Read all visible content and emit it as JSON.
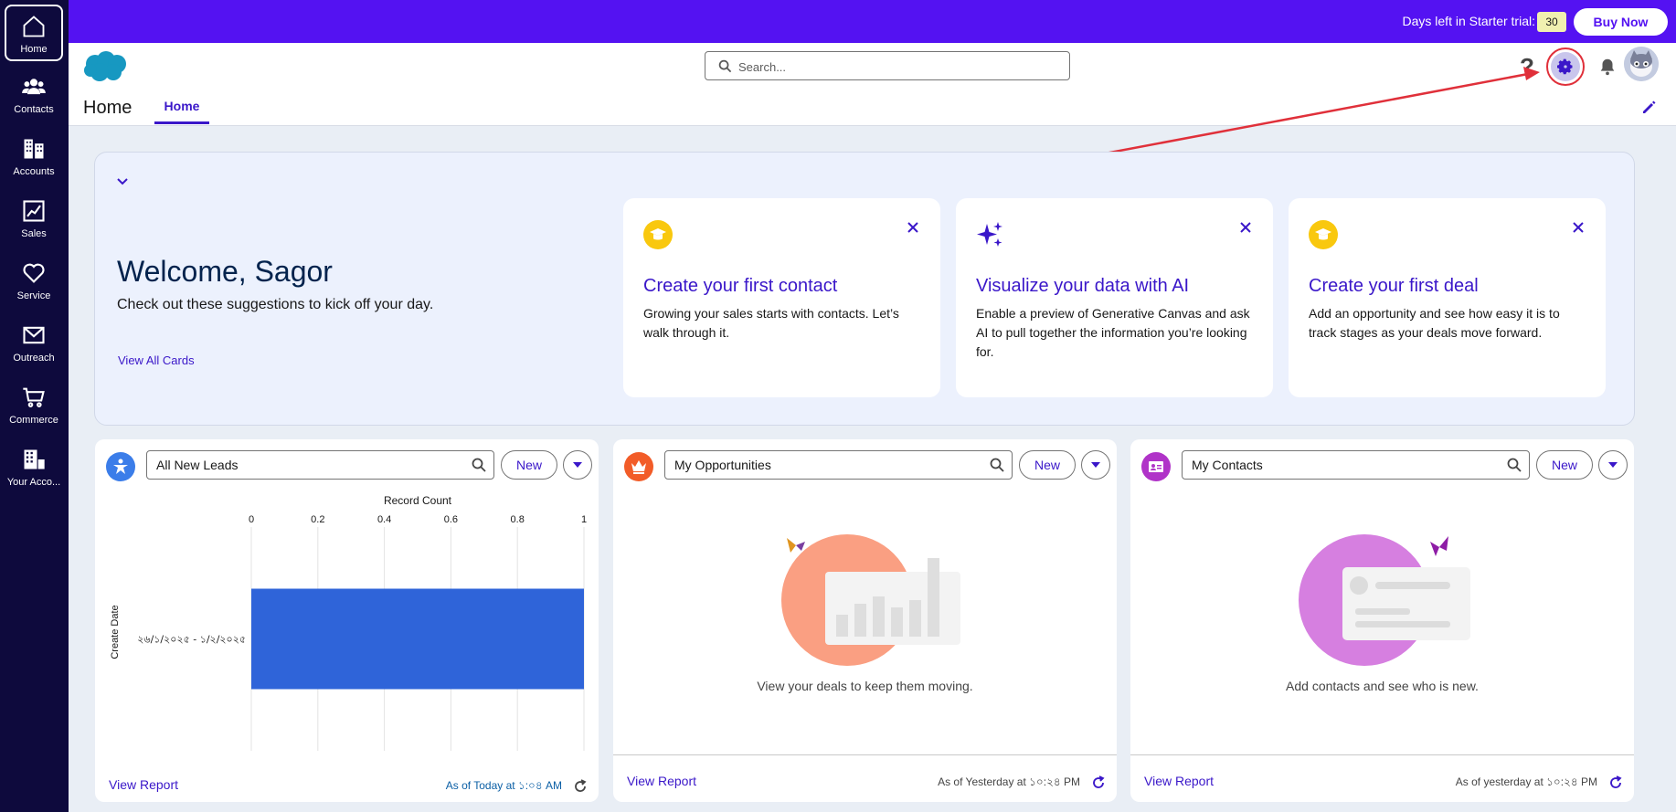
{
  "nav": [
    {
      "label": "Home",
      "icon": "home-icon"
    },
    {
      "label": "Contacts",
      "icon": "contacts-icon"
    },
    {
      "label": "Accounts",
      "icon": "accounts-icon"
    },
    {
      "label": "Sales",
      "icon": "sales-icon"
    },
    {
      "label": "Service",
      "icon": "service-icon"
    },
    {
      "label": "Outreach",
      "icon": "outreach-icon"
    },
    {
      "label": "Commerce",
      "icon": "commerce-icon"
    },
    {
      "label": "Your Acco...",
      "icon": "your-account-icon"
    }
  ],
  "trial": {
    "text": "Days left in Starter trial:",
    "days": "30",
    "buy_label": "Buy Now"
  },
  "header": {
    "search_placeholder": "Search...",
    "help_label": "?"
  },
  "app": {
    "title": "Home",
    "tab": "Home"
  },
  "welcome": {
    "title": "Welcome, Sagor",
    "subtitle": "Check out these suggestions to kick off your day.",
    "view_all": "View All Cards",
    "cards": [
      {
        "title": "Create your first contact",
        "text": "Growing your sales starts with contacts. Let’s walk through it.",
        "icon": "graduation-cap-icon"
      },
      {
        "title": "Visualize your data with AI",
        "text": "Enable a preview of Generative Canvas and ask AI to pull together the information you’re looking for.",
        "icon": "sparkles-icon"
      },
      {
        "title": "Create your first deal",
        "text": "Add an opportunity and see how easy it is to track stages as your deals move forward.",
        "icon": "graduation-cap-icon"
      }
    ]
  },
  "lists": [
    {
      "name": "All New Leads",
      "new_label": "New",
      "view_report": "View Report",
      "asof": "As of Today at ১:০৪ AM",
      "icon": "leads-icon",
      "color": "#3b7de9"
    },
    {
      "name": "My Opportunities",
      "new_label": "New",
      "view_report": "View Report",
      "asof": "As of Yesterday at ১০:২৪ PM",
      "empty_text": "View your deals to keep them moving.",
      "icon": "crown-icon",
      "color": "#f25c28"
    },
    {
      "name": "My Contacts",
      "new_label": "New",
      "view_report": "View Report",
      "asof": "As of yesterday at ১০:২৪ PM",
      "empty_text": "Add contacts and see who is new.",
      "icon": "contact-card-icon",
      "color": "#b033c8"
    }
  ],
  "chart_data": {
    "type": "bar",
    "orientation": "horizontal",
    "title": "Record Count",
    "xlabel": "Record Count",
    "ylabel": "Create Date",
    "categories": [
      "২৬/১/২০২৫ - ১/২/২০২৫"
    ],
    "values": [
      1
    ],
    "xlim": [
      0,
      1
    ],
    "ticks": [
      "0",
      "0.2",
      "0.4",
      "0.6",
      "0.8",
      "1"
    ],
    "color": "#2f64d9",
    "grid": true
  }
}
